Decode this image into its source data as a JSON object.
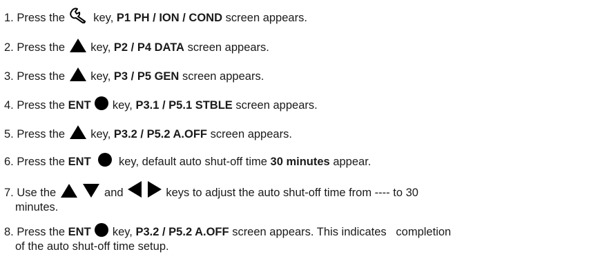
{
  "steps": [
    {
      "num": "1.",
      "t1": "Press the",
      "t2": "key,",
      "b1": "P1 PH / ION / COND",
      "t3": "screen appears."
    },
    {
      "num": "2.",
      "t1": "Press the",
      "t2": "key,",
      "b1": "P2 / P4 DATA",
      "t3": "screen appears."
    },
    {
      "num": "3.",
      "t1": "Press the",
      "t2": "key,",
      "b1": "P3 / P5 GEN",
      "t3": "screen appears."
    },
    {
      "num": "4.",
      "t1": "Press the",
      "b0": "ENT",
      "t2": "key,",
      "b1": "P3.1 / P5.1 STBLE",
      "t3": "screen appears."
    },
    {
      "num": "5.",
      "t1": "Press the",
      "t2": "key,",
      "b1": "P3.2 / P5.2 A.OFF",
      "t3": "screen appears."
    },
    {
      "num": "6.",
      "t1": "Press the",
      "b0": "ENT",
      "t2": "key, default auto shut-off time",
      "b1": "30 minutes",
      "t3": "appear."
    },
    {
      "num": "7.",
      "t1": "Use the",
      "t2": "and",
      "t3": "keys to adjust the auto shut-off time from ---- to 30",
      "t4": "minutes."
    },
    {
      "num": "8.",
      "t1": "Press the",
      "b0": "ENT",
      "t2": "key,",
      "b1": "P3.2 / P5.2 A.OFF",
      "t3": "screen appears. This indicates   completion",
      "t4": "of the auto shut-off time setup."
    }
  ],
  "icons": {
    "setup_key": "wrench-icon",
    "up_key": "up-arrow-icon",
    "down_key": "down-arrow-icon",
    "left_key": "left-arrow-icon",
    "right_key": "right-arrow-icon",
    "ent_key": "filled-circle-icon"
  },
  "colors": {
    "text": "#1a1a1a",
    "icon": "#000000"
  }
}
